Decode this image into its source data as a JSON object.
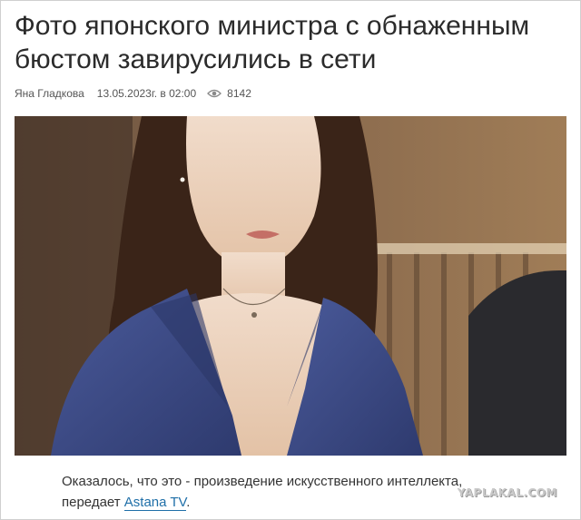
{
  "article": {
    "title_line1": "Фото японского министра с обнаженным",
    "title_line2": "бюстом завирусились в сети",
    "author": "Яна Гладкова",
    "date": "13.05.2023г. в 02:00",
    "views": "8142",
    "views_icon": "eye-icon",
    "caption_line1": "Оказалось, что это - произведение искусственного интеллекта,",
    "caption_line2_prefix": "передает ",
    "source_link": "Astana TV",
    "caption_line2_suffix": "."
  },
  "watermark": "YAPLAKAL.COM",
  "colors": {
    "link": "#1f6fa8",
    "text": "#2b2b2b",
    "meta": "#555555",
    "blazer": "#3b4a86"
  }
}
